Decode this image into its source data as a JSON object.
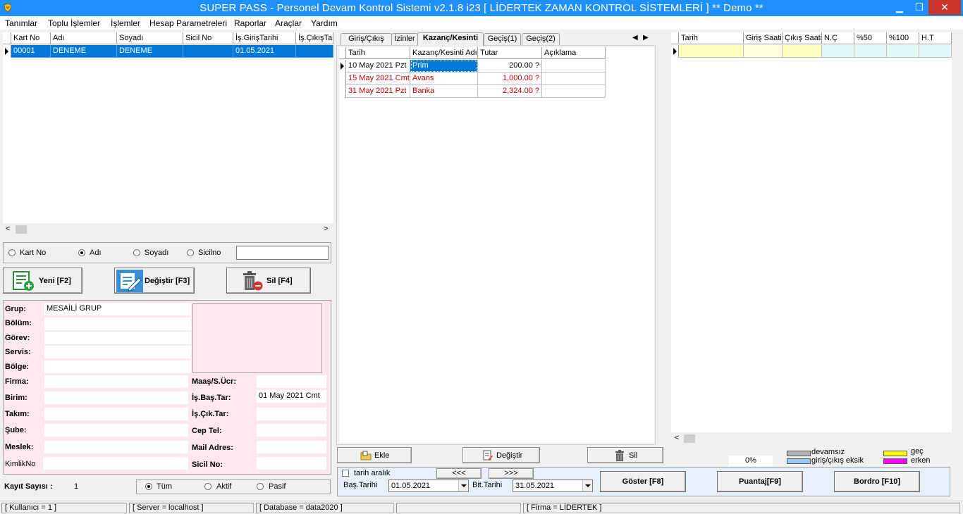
{
  "window": {
    "title": "SUPER PASS - Personel Devam Kontrol Sistemi v2.1.8 i23 [ LİDERTEK ZAMAN KONTROL  SİSTEMLERİ ]     ** Demo **",
    "minimize": "▁",
    "restore": "❐",
    "close": "✕"
  },
  "menu": [
    "Tanımlar",
    "Toplu İşlemler",
    "İşlemler",
    "Hesap Parametreleri",
    "Raporlar",
    "Araçlar",
    "Yardım"
  ],
  "personnel_grid": {
    "columns": [
      "Kart No",
      "Adı",
      "Soyadı",
      "Sicil No",
      "İş.GirişTarihi",
      "İş.ÇıkışTa"
    ],
    "rows": [
      [
        "00001",
        "DENEME",
        "DENEME",
        "",
        "01.05.2021",
        ""
      ]
    ]
  },
  "search": {
    "options": [
      "Kart No",
      "Adı",
      "Soyadı",
      "Sicilno"
    ],
    "selected": 1,
    "value": ""
  },
  "actions": {
    "new": "Yeni [F2]",
    "edit": "Değiştir [F3]",
    "delete": "Sil [F4]"
  },
  "details": {
    "labels": {
      "grup": "Grup:",
      "bolum": "Bölüm:",
      "gorev": "Görev:",
      "servis": "Servis:",
      "bolge": "Bölge:",
      "firma": "Firma:",
      "birim": "Birim:",
      "takim": "Takım:",
      "sube": "Şube:",
      "meslek": "Meslek:",
      "kimlik": "KimlikNo",
      "maas": "Maaş/S.Ücr:",
      "isbas": "İş.Baş.Tar:",
      "iscik": "İş.Çık.Tar:",
      "ceptel": "Cep Tel:",
      "mail": "Mail Adres:",
      "sicil": "Sicil No:"
    },
    "values": {
      "grup": "MESAİLİ GRUP",
      "isbas": "01 May 2021 Cmt"
    }
  },
  "record_count": {
    "label": "Kayıt Sayısı :",
    "value": "1"
  },
  "filter": {
    "options": [
      "Tüm",
      "Aktif",
      "Pasif"
    ],
    "selected": 0
  },
  "tabs": [
    "Giriş/Çıkış",
    "İzinler",
    "Kazanç/Kesinti",
    "Geçiş(1)",
    "Geçiş(2)"
  ],
  "active_tab": 2,
  "earnings_grid": {
    "columns": [
      "Tarih",
      "Kazanç/Kesinti Adı",
      "Tutar",
      "Açıklama"
    ],
    "rows": [
      {
        "date": "10 May 2021 Pzt",
        "name": "Prim",
        "amount": "200.00 ?",
        "note": ""
      },
      {
        "date": "15 May 2021 Cmt",
        "name": "Avans",
        "amount": "1,000.00 ?",
        "note": ""
      },
      {
        "date": "31 May 2021 Pzt",
        "name": "Banka",
        "amount": "2,324.00 ?",
        "note": ""
      }
    ]
  },
  "earnings_actions": {
    "add": "Ekle",
    "edit": "Değiştir",
    "delete": "Sil"
  },
  "attendance_grid": {
    "columns": [
      "Tarih",
      "Giriş Saati",
      "Çıkış Saati",
      "N.Ç",
      "%50",
      "%100",
      "H.T"
    ]
  },
  "legend": {
    "percent": "0%",
    "absent": "devamsız",
    "missing": "giriş/çıkış eksik",
    "late": "geç",
    "early": "erken",
    "colors": {
      "absent": "#b4b4b4",
      "missing": "#9ec9f0",
      "late": "#ffff00",
      "early": "#ff00ff"
    }
  },
  "date_range": {
    "checkbox_label": "tarih aralık",
    "prev": "<<<",
    "next": ">>>",
    "start_label": "Baş.Tarihi",
    "start": "01.05.2021",
    "end_label": "Bit.Tarihi",
    "end": "31.05.2021"
  },
  "bottom_actions": {
    "show": "Göster [F8]",
    "timesheet": "Puantaj[F9]",
    "payroll": "Bordro [F10]"
  },
  "status": {
    "user": "[ Kullanıcı = 1 ]",
    "server": "[ Server = localhost ]",
    "database": "[ Database = data2020 ]",
    "blank": "",
    "company": "[ Firma = LİDERTEK ]"
  }
}
